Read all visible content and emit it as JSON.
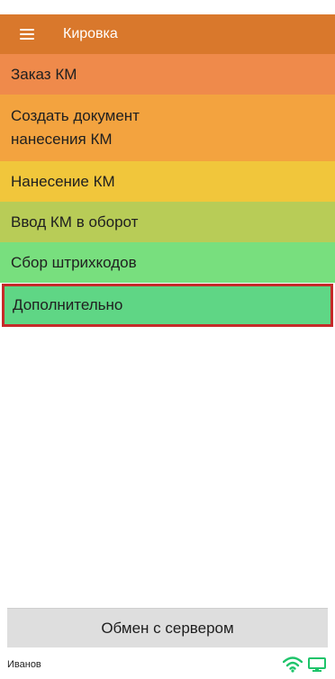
{
  "header": {
    "title": "Кировка",
    "menu_icon": "hamburger-menu-icon",
    "background": "#d9782c"
  },
  "menu": {
    "items": [
      {
        "label": "Заказ КМ",
        "color": "#ef8a4b",
        "selected": false
      },
      {
        "label": "Создать документ\nнанесения КМ",
        "color": "#f3a33f",
        "selected": false
      },
      {
        "label": "Нанесение КМ",
        "color": "#f1c63b",
        "selected": false
      },
      {
        "label": "Ввод КМ в оборот",
        "color": "#b8cc57",
        "selected": false
      },
      {
        "label": "Сбор штрихкодов",
        "color": "#78df7e",
        "selected": false
      },
      {
        "label": "Дополнительно",
        "color": "#5fd685",
        "selected": true
      }
    ]
  },
  "footer": {
    "exchange_button_label": "Обмен с сервером"
  },
  "status_bar": {
    "user": "Иванов",
    "icons": [
      "wifi-icon",
      "monitor-icon"
    ],
    "icon_color": "#1ec46a"
  }
}
